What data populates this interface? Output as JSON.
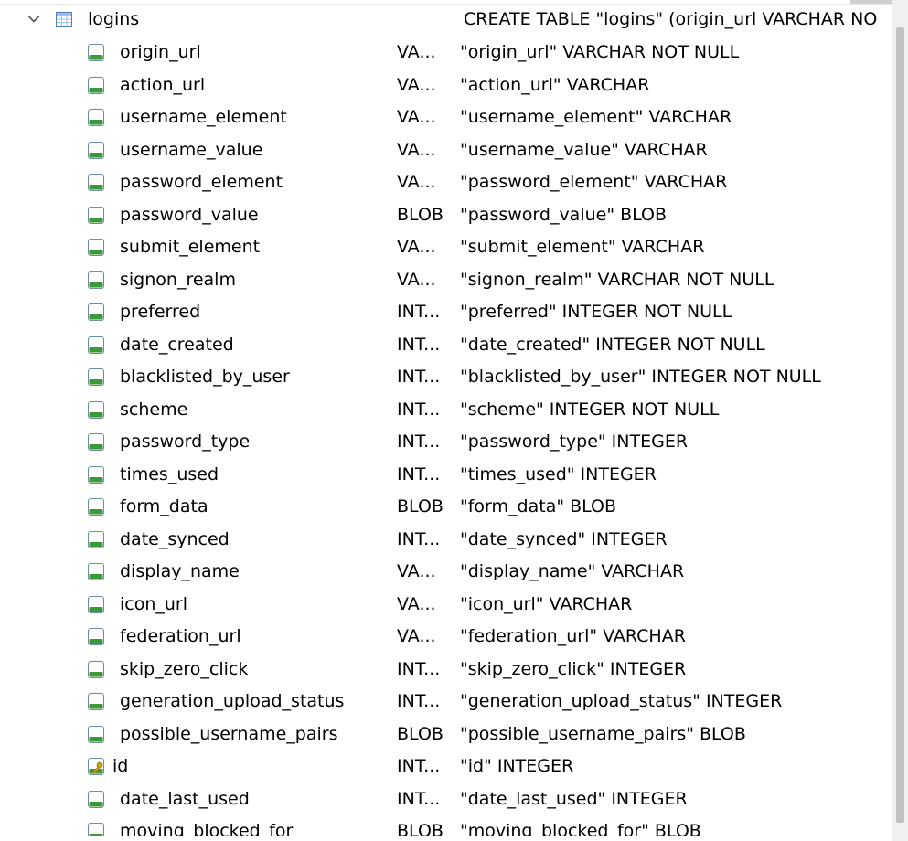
{
  "table": {
    "name": "logins",
    "schema": "CREATE TABLE \"logins\" (origin_url VARCHAR NO",
    "expander_icon": "chevron-down-icon",
    "icon": "table-icon"
  },
  "fields": [
    {
      "name": "origin_url",
      "type": "VA...",
      "schema": "\"origin_url\" VARCHAR NOT NULL",
      "icon": "field-icon"
    },
    {
      "name": "action_url",
      "type": "VA...",
      "schema": "\"action_url\" VARCHAR",
      "icon": "field-icon"
    },
    {
      "name": "username_element",
      "type": "VA...",
      "schema": "\"username_element\" VARCHAR",
      "icon": "field-icon"
    },
    {
      "name": "username_value",
      "type": "VA...",
      "schema": "\"username_value\" VARCHAR",
      "icon": "field-icon"
    },
    {
      "name": "password_element",
      "type": "VA...",
      "schema": "\"password_element\" VARCHAR",
      "icon": "field-icon"
    },
    {
      "name": "password_value",
      "type": "BLOB",
      "schema": "\"password_value\" BLOB",
      "icon": "field-icon"
    },
    {
      "name": "submit_element",
      "type": "VA...",
      "schema": "\"submit_element\" VARCHAR",
      "icon": "field-icon"
    },
    {
      "name": "signon_realm",
      "type": "VA...",
      "schema": "\"signon_realm\" VARCHAR NOT NULL",
      "icon": "field-icon"
    },
    {
      "name": "preferred",
      "type": "INT...",
      "schema": "\"preferred\" INTEGER NOT NULL",
      "icon": "field-icon"
    },
    {
      "name": "date_created",
      "type": "INT...",
      "schema": "\"date_created\" INTEGER NOT NULL",
      "icon": "field-icon"
    },
    {
      "name": "blacklisted_by_user",
      "type": "INT...",
      "schema": "\"blacklisted_by_user\" INTEGER NOT NULL",
      "icon": "field-icon"
    },
    {
      "name": "scheme",
      "type": "INT...",
      "schema": "\"scheme\" INTEGER NOT NULL",
      "icon": "field-icon"
    },
    {
      "name": "password_type",
      "type": "INT...",
      "schema": "\"password_type\" INTEGER",
      "icon": "field-icon"
    },
    {
      "name": "times_used",
      "type": "INT...",
      "schema": "\"times_used\" INTEGER",
      "icon": "field-icon"
    },
    {
      "name": "form_data",
      "type": "BLOB",
      "schema": "\"form_data\" BLOB",
      "icon": "field-icon"
    },
    {
      "name": "date_synced",
      "type": "INT...",
      "schema": "\"date_synced\" INTEGER",
      "icon": "field-icon"
    },
    {
      "name": "display_name",
      "type": "VA...",
      "schema": "\"display_name\" VARCHAR",
      "icon": "field-icon"
    },
    {
      "name": "icon_url",
      "type": "VA...",
      "schema": "\"icon_url\" VARCHAR",
      "icon": "field-icon"
    },
    {
      "name": "federation_url",
      "type": "VA...",
      "schema": "\"federation_url\" VARCHAR",
      "icon": "field-icon"
    },
    {
      "name": "skip_zero_click",
      "type": "INT...",
      "schema": "\"skip_zero_click\" INTEGER",
      "icon": "field-icon"
    },
    {
      "name": "generation_upload_status",
      "type": "INT...",
      "schema": "\"generation_upload_status\" INTEGER",
      "icon": "field-icon"
    },
    {
      "name": "possible_username_pairs",
      "type": "BLOB",
      "schema": "\"possible_username_pairs\" BLOB",
      "icon": "field-icon"
    },
    {
      "name": "id",
      "type": "INT...",
      "schema": "\"id\" INTEGER",
      "icon": "key-field-icon"
    },
    {
      "name": "date_last_used",
      "type": "INT...",
      "schema": "\"date_last_used\" INTEGER",
      "icon": "field-icon"
    },
    {
      "name": "moving_blocked_for",
      "type": "BLOB",
      "schema": "\"moving_blocked_for\" BLOB",
      "icon": "field-icon"
    }
  ],
  "colors": {
    "icon_green": "#3a9a3a",
    "icon_page": "#ffffff",
    "table_icon_blue": "#4a7fc1",
    "key_gold": "#d4a017"
  }
}
